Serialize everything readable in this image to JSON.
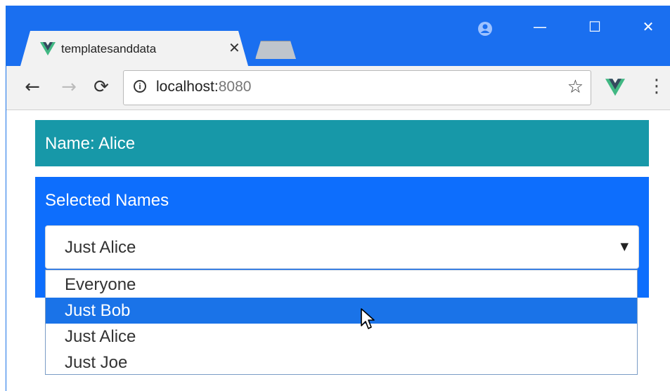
{
  "browser": {
    "tab_title": "templatesanddata",
    "tab_close": "✕",
    "url_host": "localhost:",
    "url_port": "8080",
    "window_controls": {
      "minimize": "—",
      "maximize": "☐",
      "close": "✕"
    },
    "nav": {
      "back": "←",
      "forward": "→",
      "reload": "⟳",
      "star": "☆",
      "menu": "⋮",
      "info": "i"
    }
  },
  "page": {
    "name_label": "Name: Alice",
    "selected_names_title": "Selected Names",
    "select": {
      "value": "Just Alice",
      "options": [
        "Everyone",
        "Just Bob",
        "Just Alice",
        "Just Joe"
      ],
      "highlighted_index": 1
    }
  },
  "colors": {
    "titlebar": "#1a6ff0",
    "name_banner": "#1798a8",
    "selected_panel": "#0d6efd",
    "highlight": "#1a73e8",
    "vue_green": "#41b883",
    "vue_dark": "#35495e"
  },
  "icons": {
    "favicon": "vue-logo-icon",
    "account": "account-circle-icon",
    "extension": "vue-devtools-icon",
    "pointer": "mouse-pointer-icon"
  }
}
